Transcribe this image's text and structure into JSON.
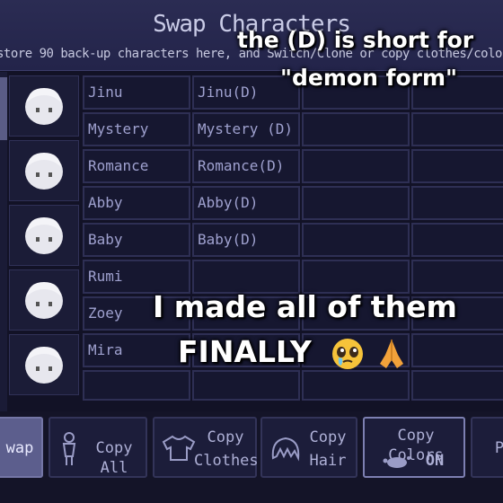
{
  "header": {
    "title": "Swap Characters",
    "subtitle": "store 90 back-up characters here, and Switch/Clone or copy clothes/colors with"
  },
  "grid": {
    "rows": [
      [
        "Jinu",
        "Jinu(D)",
        "",
        ""
      ],
      [
        "Mystery",
        "Mystery (D)",
        "",
        ""
      ],
      [
        "Romance",
        "Romance(D)",
        "",
        ""
      ],
      [
        "Abby",
        "Abby(D)",
        "",
        ""
      ],
      [
        "Baby",
        "Baby(D)",
        "",
        ""
      ],
      [
        "Rumi",
        "",
        "",
        ""
      ],
      [
        "Zoey",
        "",
        "",
        ""
      ],
      [
        "Mira",
        "",
        "",
        ""
      ],
      [
        "",
        "",
        "",
        ""
      ]
    ]
  },
  "toolbar": {
    "swap_label": "wap",
    "copy_all_label": "Copy All",
    "copy_clothes_line1": "Copy",
    "copy_clothes_line2": "Clothes",
    "copy_hair_line1": "Copy",
    "copy_hair_line2": "Hair",
    "copy_colors_line1": "Copy Colors",
    "copy_colors_state": "ON",
    "partial_label": "P"
  },
  "overlay": {
    "caption_top_line1": "the (D) is short for",
    "caption_top_line2": "\"demon form\"",
    "caption_mid_line1": "I made all of them",
    "caption_mid_line2": "FINALLY",
    "emoji_names": [
      "pleading-face-emoji",
      "folded-hands-emoji"
    ]
  },
  "colors": {
    "background": "#121226",
    "cell_text": "#9fa1cf",
    "swap_button": "#5c5e8d"
  }
}
